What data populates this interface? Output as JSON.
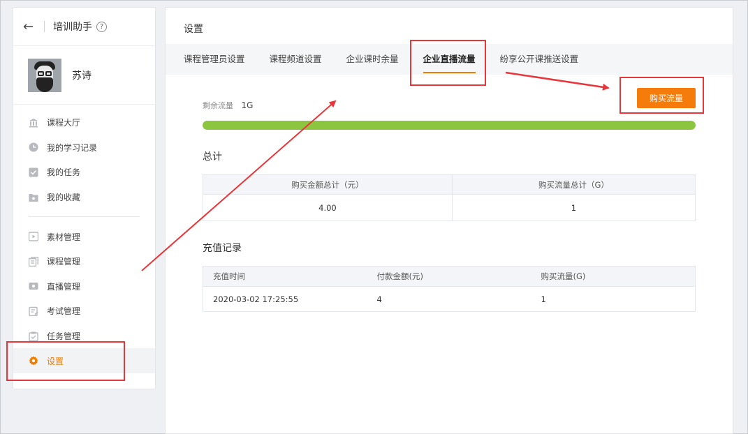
{
  "sidebar": {
    "title": "培训助手",
    "help": "?",
    "back": "←",
    "user": {
      "name": "苏诗"
    },
    "items": [
      {
        "label": "课程大厅",
        "icon": "bank-icon"
      },
      {
        "label": "我的学习记录",
        "icon": "clock-icon"
      },
      {
        "label": "我的任务",
        "icon": "check-icon"
      },
      {
        "label": "我的收藏",
        "icon": "star-folder-icon"
      }
    ],
    "manage_items": [
      {
        "label": "素材管理",
        "icon": "media-icon"
      },
      {
        "label": "课程管理",
        "icon": "course-icon"
      },
      {
        "label": "直播管理",
        "icon": "video-icon"
      },
      {
        "label": "考试管理",
        "icon": "exam-icon"
      },
      {
        "label": "任务管理",
        "icon": "task-icon"
      },
      {
        "label": "设置",
        "icon": "gear-icon",
        "active": true
      }
    ]
  },
  "main": {
    "title": "设置",
    "tabs": [
      {
        "label": "课程管理员设置"
      },
      {
        "label": "课程频道设置"
      },
      {
        "label": "企业课时余量"
      },
      {
        "label": "企业直播流量",
        "active": true
      },
      {
        "label": "纷享公开课推送设置"
      }
    ],
    "remain_label": "剩余流量",
    "remain_value": "1G",
    "remain_fraction": 1.0,
    "buy_button": "购买流量",
    "total_title": "总计",
    "total_headers": [
      "购买金额总计（元）",
      "购买流量总计（G）"
    ],
    "total_values": [
      "4.00",
      "1"
    ],
    "record_title": "充值记录",
    "record_headers": [
      "充值时间",
      "付款金额(元)",
      "购买流量(G)"
    ],
    "records": [
      [
        "2020-03-02 17:25:55",
        "4",
        "1"
      ]
    ]
  },
  "colors": {
    "accent": "#f07d00",
    "button": "#f57c0a",
    "progress": "#8cc640",
    "annotation": "#e8363a"
  }
}
